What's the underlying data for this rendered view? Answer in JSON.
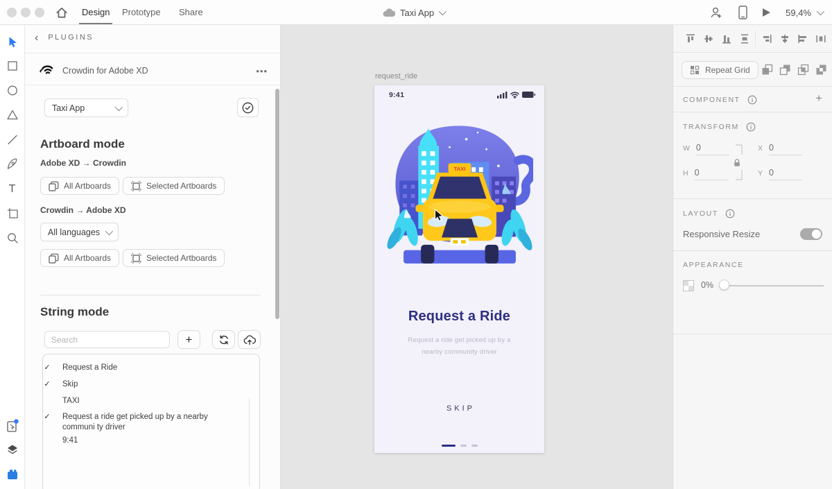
{
  "topbar": {
    "tabs": [
      {
        "label": "Design"
      },
      {
        "label": "Prototype"
      },
      {
        "label": "Share"
      }
    ],
    "document_title": "Taxi App",
    "zoom_level": "59,4%"
  },
  "plugin_panel": {
    "back_glyph": "‹",
    "back_label": "PLUGINS",
    "plugin_title": "Crowdin for Adobe XD",
    "menu_glyph": "•••",
    "project_select_value": "Taxi App",
    "check_glyph": "✓",
    "artboard_mode": {
      "heading": "Artboard mode",
      "direction_push": "Adobe XD → Crowdin",
      "direction_pull": "Crowdin → Adobe XD",
      "all_artboards_label": "All Artboards",
      "selected_artboards_label": "Selected Artboards",
      "languages_select_value": "All languages"
    },
    "string_mode": {
      "heading": "String mode",
      "search_placeholder": "Search",
      "add_glyph": "+",
      "strings": [
        {
          "check": "✓",
          "text": "Request a Ride"
        },
        {
          "check": "✓",
          "text": "Skip"
        },
        {
          "check": "",
          "text": "TAXI"
        },
        {
          "check": "✓",
          "text": "Request a ride get picked up by a nearby communi ty driver"
        },
        {
          "check": "",
          "text": "9:41"
        }
      ]
    }
  },
  "canvas": {
    "artboard_name": "request_ride",
    "phone": {
      "status_time": "9:41",
      "title": "Request a Ride",
      "subtitle_line1": "Request a ride get picked up by a",
      "subtitle_line2": "nearby community driver",
      "skip_label": "SKIP",
      "taxi_sign": "TAXI"
    }
  },
  "right_panel": {
    "repeat_grid_label": "Repeat Grid",
    "component": {
      "label": "COMPONENT",
      "add_glyph": "+"
    },
    "transform": {
      "label": "TRANSFORM",
      "fields": [
        {
          "label": "W",
          "value": "0"
        },
        {
          "label": "X",
          "value": "0"
        },
        {
          "label": "H",
          "value": "0"
        },
        {
          "label": "Y",
          "value": "0"
        }
      ]
    },
    "layout_label": "LAYOUT",
    "responsive_resize_label": "Responsive Resize",
    "appearance": {
      "label": "APPEARANCE",
      "opacity": "0%"
    }
  },
  "colors": {
    "accent_blue": "#2f7cf6",
    "title_indigo": "#2d2e83",
    "taxi_yellow": "#ffc513",
    "canvas_bg": "#e5e5e6"
  }
}
